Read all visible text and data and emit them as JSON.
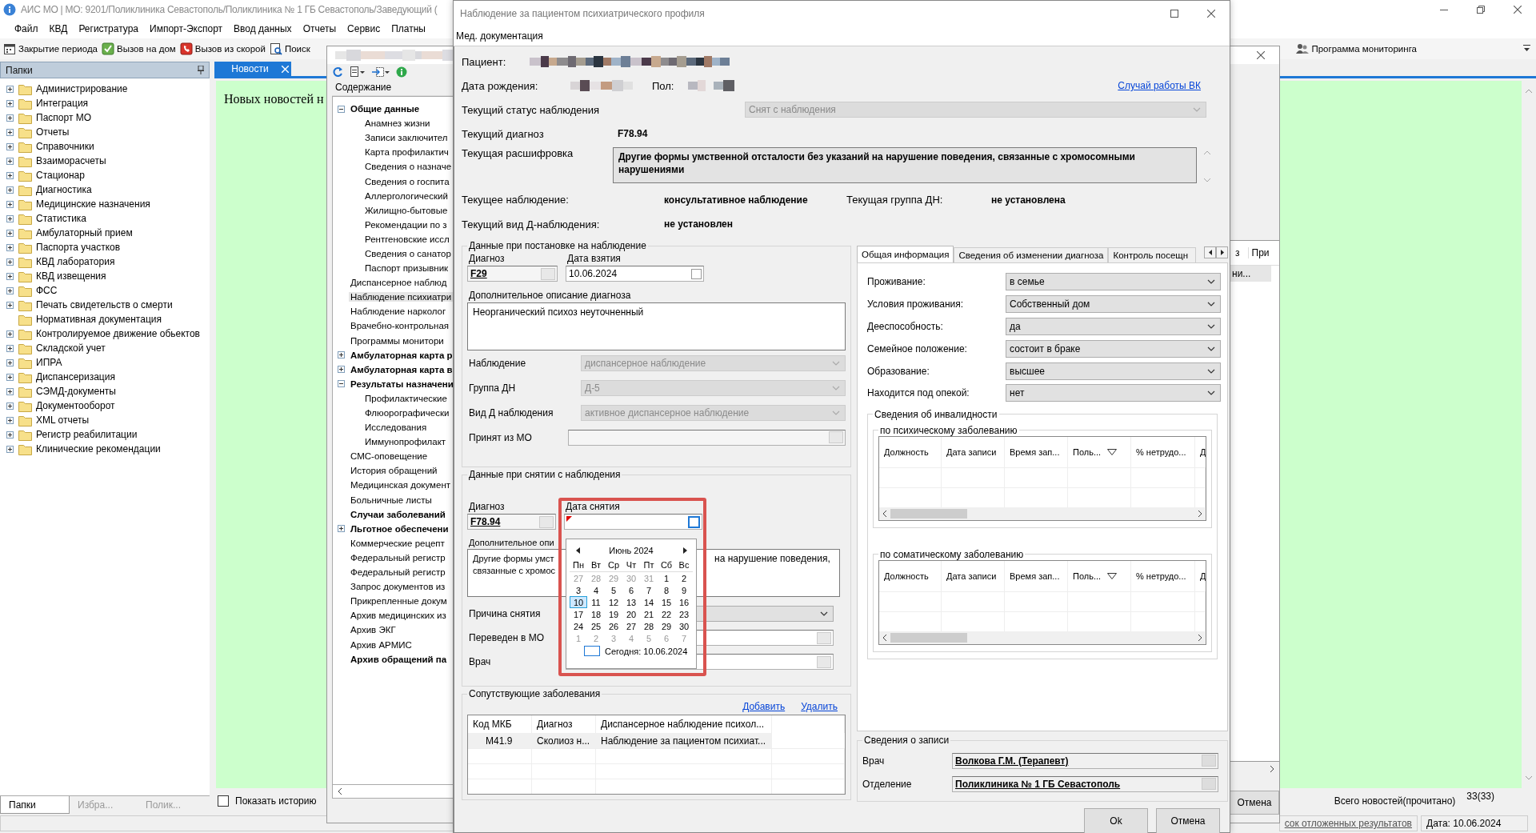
{
  "app": {
    "title": "АИС МО | МО: 9201/Поликлиника Севастополь/Поликлиника № 1 ГБ Севастополь/Заведующий (",
    "menu": [
      "Файл",
      "КВД",
      "Регистратура",
      "Импорт-Экспорт",
      "Ввод данных",
      "Отчеты",
      "Сервис",
      "Платны"
    ],
    "toolbar": [
      {
        "label": "Закрытие периода",
        "kind": "calendar"
      },
      {
        "label": "Вызов на дом",
        "kind": "check"
      },
      {
        "label": "Вызов из скорой",
        "kind": "phone"
      },
      {
        "label": "Поиск",
        "kind": "search"
      }
    ],
    "toolbar_right": {
      "label": "Программа мониторинга"
    }
  },
  "folders": {
    "title": "Папки",
    "items": [
      {
        "label": "Администрирование",
        "expanded": false
      },
      {
        "label": "Интеграция",
        "expanded": false
      },
      {
        "label": "Паспорт МО",
        "expanded": false
      },
      {
        "label": "Отчеты",
        "expanded": false
      },
      {
        "label": "Справочники",
        "expanded": false
      },
      {
        "label": "Взаиморасчеты",
        "expanded": false
      },
      {
        "label": "Стационар",
        "expanded": false
      },
      {
        "label": "Диагностика",
        "expanded": false
      },
      {
        "label": "Медицинские назначения",
        "expanded": false
      },
      {
        "label": "Статистика",
        "expanded": false
      },
      {
        "label": "Амбулаторный прием",
        "expanded": false
      },
      {
        "label": "Паспорта участков",
        "expanded": false
      },
      {
        "label": "КВД лаборатория",
        "expanded": false
      },
      {
        "label": "КВД извещения",
        "expanded": false
      },
      {
        "label": "ФСС",
        "expanded": false
      },
      {
        "label": "Печать свидетельств о смерти",
        "expanded": false
      },
      {
        "label": "Нормативная документация"
      },
      {
        "label": "Контролируемое движение обьектов",
        "expanded": false
      },
      {
        "label": "Складской учет",
        "expanded": false
      },
      {
        "label": "ИПРА",
        "expanded": false
      },
      {
        "label": "Диспансеризация",
        "expanded": false
      },
      {
        "label": "СЭМД-документы",
        "expanded": false
      },
      {
        "label": "Документооборот",
        "expanded": false
      },
      {
        "label": "XML отчеты",
        "expanded": false
      },
      {
        "label": "Регистр реабилитации",
        "expanded": false
      },
      {
        "label": "Клинические рекомендации",
        "expanded": false
      }
    ],
    "tabs": [
      {
        "label": "Папки",
        "selected": true
      },
      {
        "label": "Избра...",
        "selected": false
      },
      {
        "label": "Полик...",
        "selected": false
      }
    ]
  },
  "news": {
    "tab": "Новости",
    "message": "Новых новостей н",
    "show_history": {
      "label": "Показать историю",
      "checked": false
    },
    "total_label": "Всего новостей(прочитано)",
    "total_count": "33(33)"
  },
  "status_bar": {
    "link": "сок отложенных результатов",
    "date": "Дата: 10.06.2024"
  },
  "record_window": {
    "section": "Содержание",
    "tree": [
      {
        "label": "Общие данные",
        "bold": true,
        "selected": false,
        "expanded": true,
        "children": [
          {
            "label": "Анамнез жизни",
            "bold": false,
            "selected": false
          },
          {
            "label": "Записи заключител",
            "bold": false,
            "selected": false
          },
          {
            "label": "Карта профилактич",
            "bold": false,
            "selected": false
          },
          {
            "label": "Сведения о назначе",
            "bold": false,
            "selected": false
          },
          {
            "label": "Сведения о госпита",
            "bold": false,
            "selected": false
          },
          {
            "label": "Аллергологический",
            "bold": false,
            "selected": false
          },
          {
            "label": "Жилищно-бытовые",
            "bold": false,
            "selected": false
          },
          {
            "label": "Рекомендации по з",
            "bold": false,
            "selected": false
          },
          {
            "label": "Рентгеновские иссл",
            "bold": false,
            "selected": false
          },
          {
            "label": "Сведения о санатор",
            "bold": false,
            "selected": false
          },
          {
            "label": "Паспорт призывник",
            "bold": false,
            "selected": false
          }
        ]
      },
      {
        "label": "Диспансерное наблюд",
        "bold": false,
        "selected": false
      },
      {
        "label": "Наблюдение психиатри",
        "bold": false,
        "selected": true
      },
      {
        "label": "Наблюдение нарколог",
        "bold": false,
        "selected": false
      },
      {
        "label": "Врачебно-контрольная",
        "bold": false,
        "selected": false
      },
      {
        "label": "Программы монитори",
        "bold": false,
        "selected": false
      },
      {
        "label": "Амбулаторная карта р",
        "bold": true,
        "selected": false,
        "expanded": false
      },
      {
        "label": "Амбулаторная карта в",
        "bold": true,
        "selected": false,
        "expanded": false
      },
      {
        "label": "Результаты назначени",
        "bold": true,
        "selected": false,
        "expanded": true,
        "children": [
          {
            "label": "Профилактические",
            "bold": false,
            "selected": false
          },
          {
            "label": "Флюорографически",
            "bold": false,
            "selected": false
          },
          {
            "label": "Исследования",
            "bold": false,
            "selected": false
          },
          {
            "label": "Иммунопрофилакт",
            "bold": false,
            "selected": false
          }
        ]
      },
      {
        "label": "СМС-оповещение",
        "bold": false,
        "selected": false
      },
      {
        "label": "История обращений",
        "bold": false,
        "selected": false
      },
      {
        "label": "Медицинская документ",
        "bold": false,
        "selected": false
      },
      {
        "label": "Больничные листы",
        "bold": false,
        "selected": false
      },
      {
        "label": "Случаи заболеваний",
        "bold": true,
        "selected": false
      },
      {
        "label": "Льготное обеспечени",
        "bold": true,
        "selected": false,
        "expanded": false
      },
      {
        "label": "Коммерческие рецепт",
        "bold": false,
        "selected": false
      },
      {
        "label": "Федеральный регистр",
        "bold": false,
        "selected": false
      },
      {
        "label": "Федеральный регистр",
        "bold": false,
        "selected": false
      },
      {
        "label": "Запрос документов из",
        "bold": false,
        "selected": false
      },
      {
        "label": "Прикрепленные докум",
        "bold": false,
        "selected": false
      },
      {
        "label": "Архив медицинских из",
        "bold": false,
        "selected": false
      },
      {
        "label": "Архив ЭКГ",
        "bold": false,
        "selected": false
      },
      {
        "label": "Архив АРМИС",
        "bold": false,
        "selected": false
      },
      {
        "label": "Архив обращений па",
        "bold": true,
        "selected": false
      }
    ],
    "columns": [
      "з",
      "При"
    ],
    "row_fragment": "ни...",
    "cancel_button": "Отмена"
  },
  "dialog": {
    "title": "Наблюдение за пациентом психиатрического профиля",
    "menu": [
      "Мед. документация"
    ],
    "patient_label": "Пациент:",
    "birth_label": "Дата рождения:",
    "sex_label": "Пол:",
    "vk_link": "Случай работы ВК",
    "status": {
      "label": "Текущий статус наблюдения",
      "value": "Снят с наблюдения",
      "disabled": true
    },
    "diagnosis": {
      "label": "Текущий диагноз",
      "value": "F78.94"
    },
    "decoding": {
      "label": "Текущая расшифровка",
      "value": "Другие формы умственной отсталости без указаний на нарушение поведения, связанные с хромосомными нарушениями"
    },
    "observation": {
      "label": "Текущее наблюдение:",
      "value": "консультативное наблюдение"
    },
    "group_dn": {
      "label": "Текущая группа ДН:",
      "value": "не установлена"
    },
    "d_type": {
      "label": "Текущий вид Д-наблюдения:",
      "value": "не установлен"
    },
    "registration": {
      "title": "Данные при постановке на наблюдение",
      "diagnosis": {
        "label": "Диагноз",
        "value": "F29"
      },
      "date": {
        "label": "Дата взятия",
        "value": "10.06.2024",
        "checked": false,
        "focused": false,
        "invalid": false
      },
      "description": {
        "label": "Дополнительное описание диагноза",
        "value": "Неорганический психоз неуточненный"
      },
      "combos": [
        {
          "label": "Наблюдение",
          "value": "диспансерное наблюдение",
          "disabled": true
        },
        {
          "label": "Группа ДН",
          "value": "Д-5",
          "disabled": true
        },
        {
          "label": "Вид Д наблюдения",
          "value": "активное диспансерное наблюдение",
          "disabled": true
        }
      ],
      "from_mo": {
        "label": "Принят из МО"
      }
    },
    "removal": {
      "title": "Данные при снятии с наблюдения",
      "diagnosis": {
        "label": "Диагноз",
        "value": "F78.94"
      },
      "date": {
        "label": "Дата снятия",
        "checked": false,
        "focused": true,
        "invalid": true
      },
      "description": {
        "label": "Дополнительное опи",
        "left_lines": [
          "Другие формы умст",
          "связанные с хромос"
        ],
        "right_lines": [
          "на нарушение поведения,"
        ]
      },
      "reason": {
        "label": "Причина снятия"
      },
      "moved_to": {
        "label": "Переведен в МО"
      },
      "doctor": {
        "label": "Врач"
      }
    },
    "calendar": {
      "month": "Июнь 2024",
      "weekdays": [
        "Пн",
        "Вт",
        "Ср",
        "Чт",
        "Пт",
        "Сб",
        "Вс"
      ],
      "weeks": [
        [
          {
            "text": "27",
            "other_month": true,
            "selected": false
          },
          {
            "text": "28",
            "other_month": true,
            "selected": false
          },
          {
            "text": "29",
            "other_month": true,
            "selected": false
          },
          {
            "text": "30",
            "other_month": true,
            "selected": false
          },
          {
            "text": "31",
            "other_month": true,
            "selected": false
          },
          {
            "text": "1",
            "other_month": false,
            "selected": false
          },
          {
            "text": "2",
            "other_month": false,
            "selected": false
          }
        ],
        [
          {
            "text": "3",
            "other_month": false,
            "selected": false
          },
          {
            "text": "4",
            "other_month": false,
            "selected": false
          },
          {
            "text": "5",
            "other_month": false,
            "selected": false
          },
          {
            "text": "6",
            "other_month": false,
            "selected": false
          },
          {
            "text": "7",
            "other_month": false,
            "selected": false
          },
          {
            "text": "8",
            "other_month": false,
            "selected": false
          },
          {
            "text": "9",
            "other_month": false,
            "selected": false
          }
        ],
        [
          {
            "text": "10",
            "other_month": false,
            "selected": true
          },
          {
            "text": "11",
            "other_month": false,
            "selected": false
          },
          {
            "text": "12",
            "other_month": false,
            "selected": false
          },
          {
            "text": "13",
            "other_month": false,
            "selected": false
          },
          {
            "text": "14",
            "other_month": false,
            "selected": false
          },
          {
            "text": "15",
            "other_month": false,
            "selected": false
          },
          {
            "text": "16",
            "other_month": false,
            "selected": false
          }
        ],
        [
          {
            "text": "17",
            "other_month": false,
            "selected": false
          },
          {
            "text": "18",
            "other_month": false,
            "selected": false
          },
          {
            "text": "19",
            "other_month": false,
            "selected": false
          },
          {
            "text": "20",
            "other_month": false,
            "selected": false
          },
          {
            "text": "21",
            "other_month": false,
            "selected": false
          },
          {
            "text": "22",
            "other_month": false,
            "selected": false
          },
          {
            "text": "23",
            "other_month": false,
            "selected": false
          }
        ],
        [
          {
            "text": "24",
            "other_month": false,
            "selected": false
          },
          {
            "text": "25",
            "other_month": false,
            "selected": false
          },
          {
            "text": "26",
            "other_month": false,
            "selected": false
          },
          {
            "text": "27",
            "other_month": false,
            "selected": false
          },
          {
            "text": "28",
            "other_month": false,
            "selected": false
          },
          {
            "text": "29",
            "other_month": false,
            "selected": false
          },
          {
            "text": "30",
            "other_month": false,
            "selected": false
          }
        ],
        [
          {
            "text": "1",
            "other_month": true,
            "selected": false
          },
          {
            "text": "2",
            "other_month": true,
            "selected": false
          },
          {
            "text": "3",
            "other_month": true,
            "selected": false
          },
          {
            "text": "4",
            "other_month": true,
            "selected": false
          },
          {
            "text": "5",
            "other_month": true,
            "selected": false
          },
          {
            "text": "6",
            "other_month": true,
            "selected": false
          },
          {
            "text": "7",
            "other_month": true,
            "selected": false
          }
        ]
      ],
      "today": "Сегодня: 10.06.2024"
    },
    "comorbid": {
      "title": "Сопутствующие заболевания",
      "add": "Добавить",
      "remove": "Удалить",
      "columns": [
        "Код МКБ",
        "Диагноз",
        "Диспансерное наблюдение психол..."
      ],
      "rows": [
        [
          "M41.9",
          "Сколиоз н...",
          "Наблюдение за пациентом психиат..."
        ]
      ]
    },
    "tabs": [
      {
        "label": "Общая информация",
        "selected": true
      },
      {
        "label": "Сведения об изменении диагноза",
        "selected": false
      },
      {
        "label": "Контроль посещн",
        "selected": false
      }
    ],
    "general": [
      {
        "label": "Проживание:",
        "value": "в семье"
      },
      {
        "label": "Условия проживания:",
        "value": "Собственный дом"
      },
      {
        "label": "Дееспособность:",
        "value": "да"
      },
      {
        "label": "Семейное положение:",
        "value": "состоит в браке"
      },
      {
        "label": "Образование:",
        "value": "высшее"
      },
      {
        "label": "Находится под опекой:",
        "value": "нет"
      }
    ],
    "disability": {
      "title": "Сведения об инвалидности",
      "sections": [
        {
          "title": "по психическому заболеванию",
          "columns": [
            "Должность",
            "Дата записи",
            "Время зап...",
            "Поль...",
            "% нетрудо...",
            "Д"
          ]
        },
        {
          "title": "по соматическому заболеванию",
          "columns": [
            "Должность",
            "Дата записи",
            "Время зап...",
            "Поль...",
            "% нетрудо...",
            "Д"
          ]
        }
      ]
    },
    "record": {
      "title": "Сведения о записи",
      "fields": [
        {
          "label": "Врач",
          "value": "Волкова Г.М. (Терапевт)"
        },
        {
          "label": "Отделение",
          "value": "Поликлиника № 1 ГБ Севастополь"
        }
      ]
    },
    "buttons": [
      "Ok",
      "Отмена"
    ]
  }
}
